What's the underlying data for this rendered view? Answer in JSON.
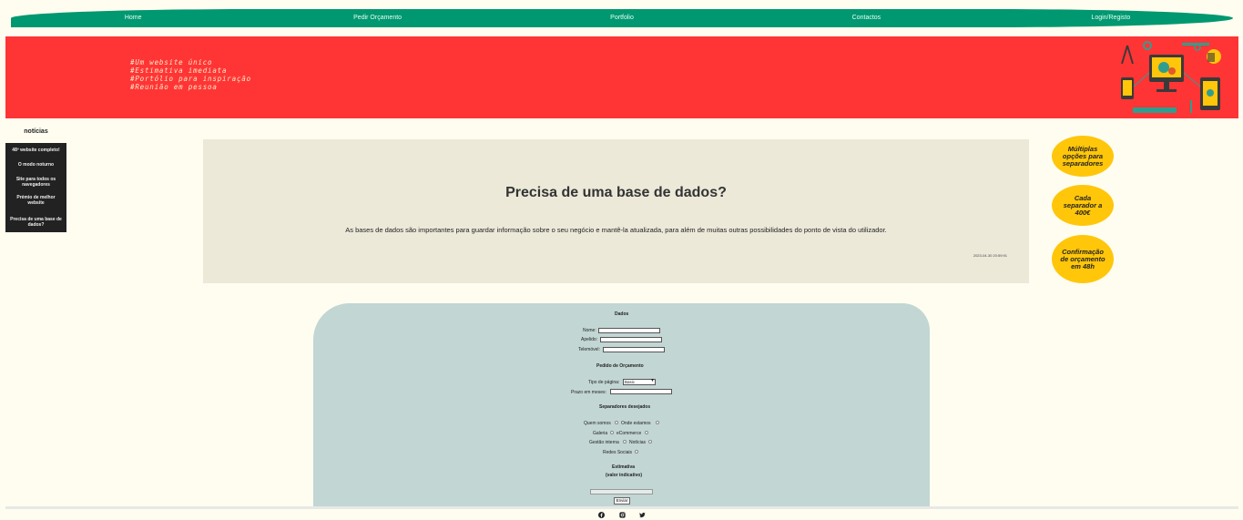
{
  "nav": {
    "items": [
      "Home",
      "Pedir Orçamento",
      "Portfolio",
      "Contactos",
      "Login/Registo"
    ]
  },
  "banner": {
    "tags": [
      "#Um website único",
      "#Estimativa imediata",
      "#Portólio para inspiração",
      "#Reunião em pessoa"
    ],
    "illustration": "computer-settings-illustration"
  },
  "sidebar": {
    "title": "notícias",
    "items": [
      "48º website completo!",
      "O modo noturno",
      "Site para todos os navegadores",
      "Prémio de melhor website",
      "Precisa de uma base de dados?"
    ]
  },
  "article": {
    "title": "Precisa de uma base de dados?",
    "body": "As bases de dados são importantes para guardar informação sobre o seu negócio e mantê-la atualizada, para além de muitas outras possibilidades do ponto de vista do utilizador.",
    "date": "2023-04-30 20:59:91"
  },
  "bubbles": [
    "Múltiplas opções para separadores",
    "Cada separador a 400€",
    "Confirmação de orçamento em 48h"
  ],
  "form": {
    "dados_title": "Dados",
    "nome_label": "Nome:",
    "apelido_label": "Apelido:",
    "telemovel_label": "Telemóvel:",
    "pedido_title": "Pedido de Orçamento",
    "tipo_label": "Tipo de página:",
    "tipo_value": "Basic",
    "prazo_label": "Prazo em meses:",
    "separadores_title": "Separadores desejados",
    "options": [
      "Quem somos",
      "Onde estamos",
      "Galeria",
      "eCommerce",
      "Gestão interna",
      "Notícias",
      "Redes Sociais"
    ],
    "estimativa_title": "Estimativa",
    "estimativa_sub": "(valor indicativo)",
    "submit_label": "Enviar"
  },
  "footer": {
    "icons": [
      "facebook-icon",
      "instagram-icon",
      "twitter-icon"
    ]
  },
  "colors": {
    "nav": "#009870",
    "banner": "#ff3535",
    "bubble": "#ffc60a",
    "form": "#c2d6d4",
    "article": "#ece9d9",
    "sidebar": "#222222"
  }
}
